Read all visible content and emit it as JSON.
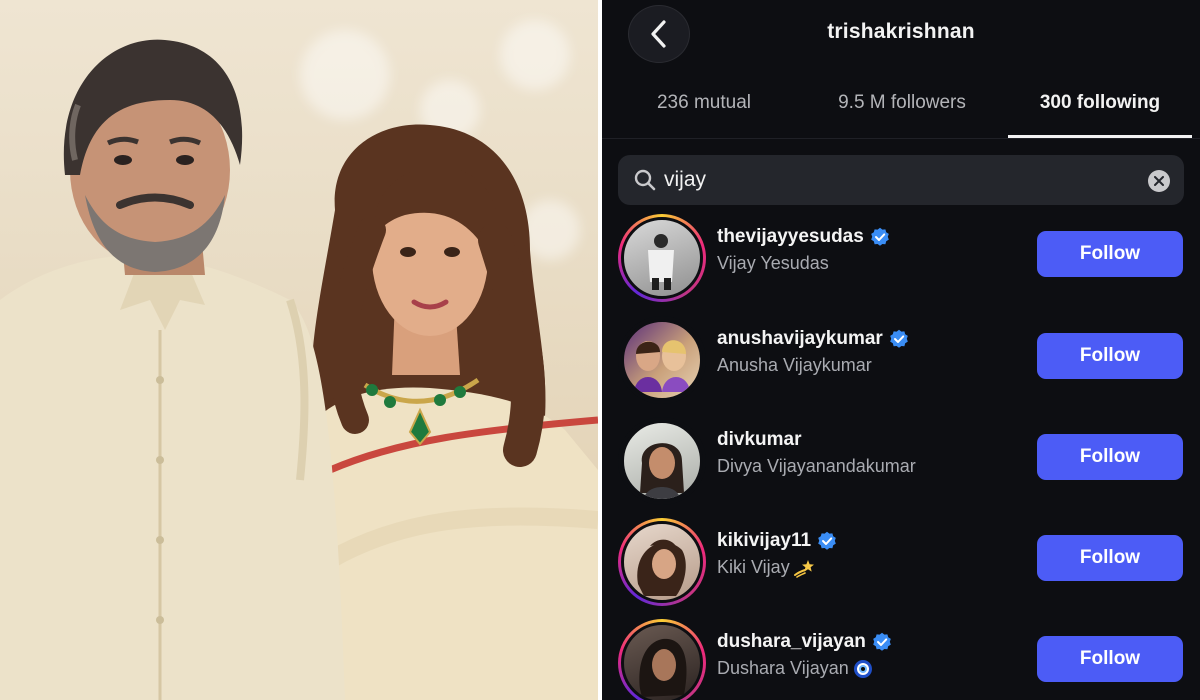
{
  "profile": {
    "username": "trishakrishnan"
  },
  "tabs": [
    {
      "label": "236 mutual",
      "active": false
    },
    {
      "label": "9.5 M followers",
      "active": false
    },
    {
      "label": "300 following",
      "active": true
    }
  ],
  "search": {
    "value": "vijay"
  },
  "accent_color": "#4c5cf6",
  "results": [
    {
      "username": "thevijayyesudas",
      "full_name": "Vijay Yesudas",
      "verified": true,
      "story_ring": true,
      "emoji": "",
      "button": "Follow"
    },
    {
      "username": "anushavijaykumar",
      "full_name": "Anusha Vijaykumar",
      "verified": true,
      "story_ring": false,
      "emoji": "",
      "button": "Follow"
    },
    {
      "username": "divkumar",
      "full_name": "Divya Vijayanandakumar",
      "verified": false,
      "story_ring": false,
      "emoji": "",
      "button": "Follow"
    },
    {
      "username": "kikivijay11",
      "full_name": "Kiki Vijay",
      "verified": true,
      "story_ring": true,
      "emoji": "dizzy-star",
      "button": "Follow"
    },
    {
      "username": "dushara_vijayan",
      "full_name": "Dushara Vijayan",
      "verified": true,
      "story_ring": true,
      "emoji": "nazar-amulet",
      "button": "Follow"
    }
  ]
}
